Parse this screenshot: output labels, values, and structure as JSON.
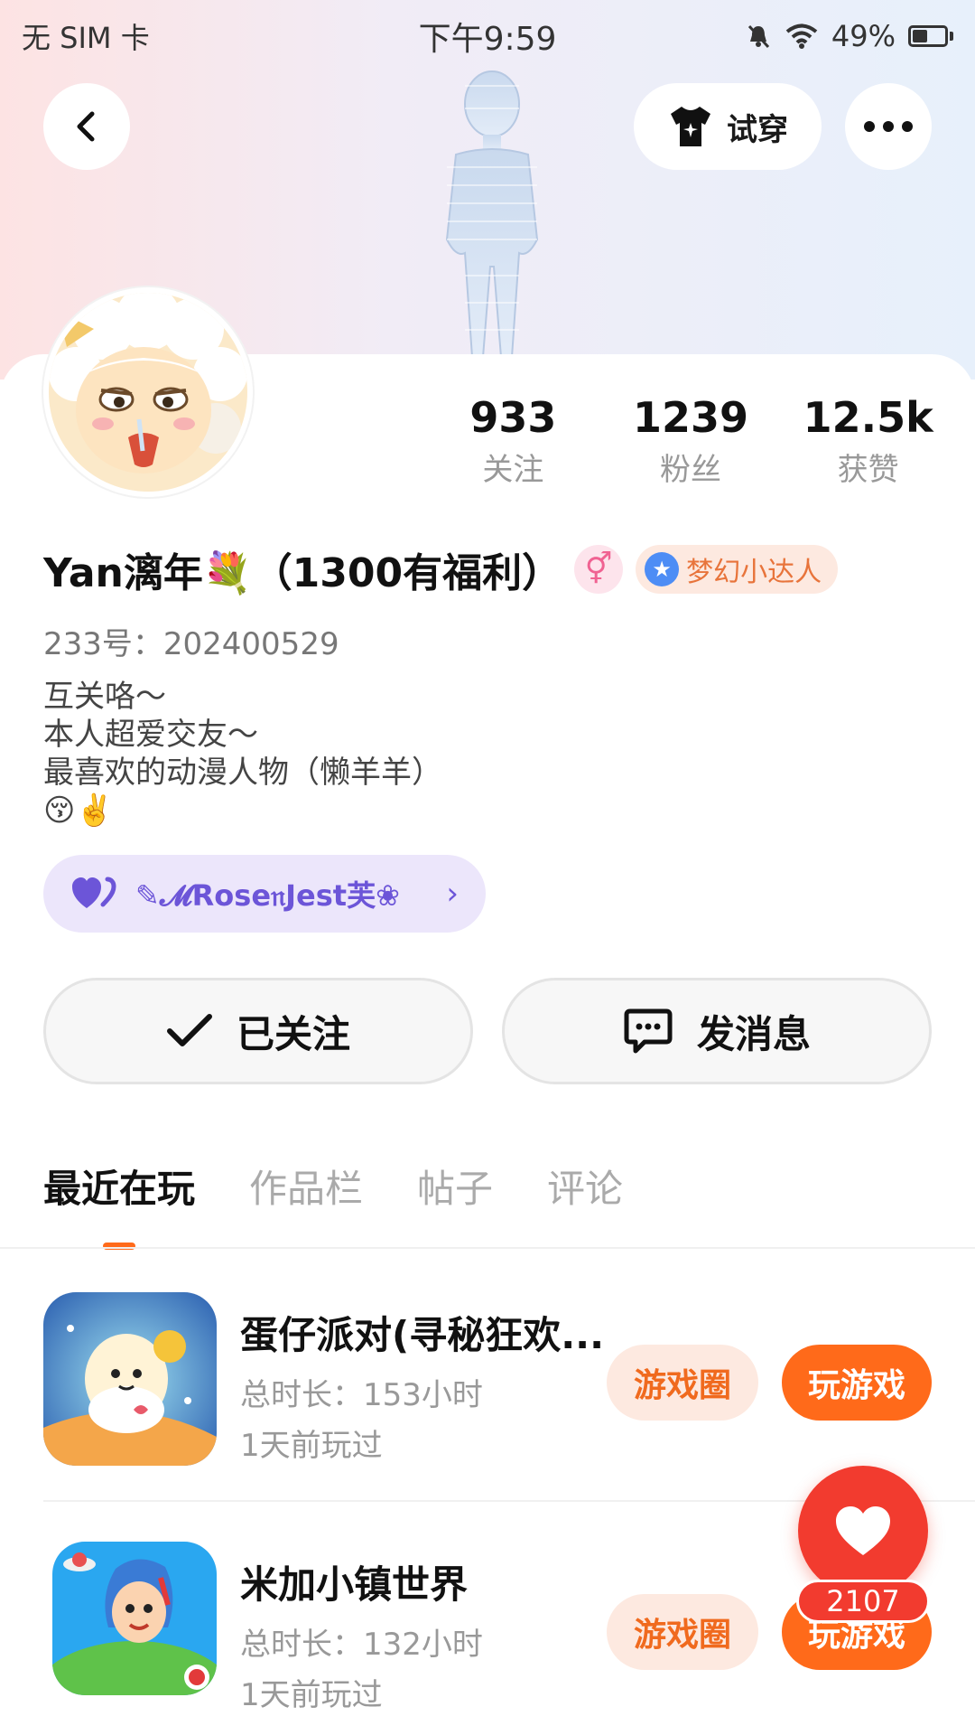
{
  "status_bar": {
    "carrier": "无 SIM 卡",
    "time": "下午9:59",
    "battery": "49%"
  },
  "header": {
    "try_on_label": "试穿"
  },
  "stats": [
    {
      "value": "933",
      "label": "关注"
    },
    {
      "value": "1239",
      "label": "粉丝"
    },
    {
      "value": "12.5k",
      "label": "获赞"
    }
  ],
  "profile": {
    "name": "Yan漓年💐（1300有福利）",
    "gender_symbol": "⚥",
    "level_badge": "梦幻小达人",
    "uid": "233号：202400529",
    "bio": [
      "互关咯～",
      "本人超爱交友～",
      "最喜欢的动漫人物（懒羊羊）",
      "😚✌️"
    ],
    "link_text": "✎𝓜Rose𝔫Jest芙❀"
  },
  "actions": {
    "follow_label": "已关注",
    "message_label": "发消息"
  },
  "tabs": [
    "最近在玩",
    "作品栏",
    "帖子",
    "评论"
  ],
  "games": [
    {
      "title": "蛋仔派对(寻秘狂欢...",
      "duration": "总时长：153小时",
      "last_played": "1天前玩过",
      "circle_label": "游戏圈",
      "play_label": "玩游戏"
    },
    {
      "title": "米加小镇世界",
      "duration": "总时长：132小时",
      "last_played": "1天前玩过",
      "circle_label": "游戏圈",
      "play_label": "玩游戏"
    }
  ],
  "like_fab": {
    "count": "2107"
  },
  "colors": {
    "accent": "#ff6a1a",
    "like": "#f23b2f",
    "link_bg": "#ece6fb"
  }
}
